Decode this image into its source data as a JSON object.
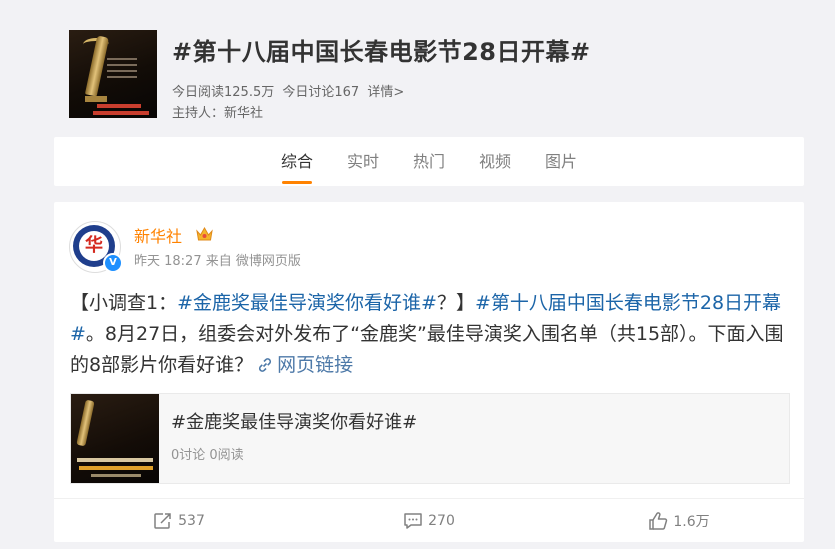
{
  "topic": {
    "title": "#第十八届中国长春电影节28日开幕#",
    "reads_today": "今日阅读125.5万",
    "discussions_today": "今日讨论167",
    "details_link": "详情>",
    "host_label": "主持人：",
    "host_name": "新华社"
  },
  "tabs": [
    {
      "label": "综合",
      "active": true
    },
    {
      "label": "实时",
      "active": false
    },
    {
      "label": "热门",
      "active": false
    },
    {
      "label": "视频",
      "active": false
    },
    {
      "label": "图片",
      "active": false
    }
  ],
  "post": {
    "author": "新华社",
    "time": "昨天 18:27",
    "source": "来自 微博网页版",
    "text_part1": "【小调查1：",
    "hashtag1": "#金鹿奖最佳导演奖你看好谁#",
    "text_part2": "？】",
    "hashtag2": "#第十八届中国长春电影节28日开幕#",
    "text_part3": "。8月27日，组委会对外发布了“金鹿奖”最佳导演奖入围名单（共15部）。下面入围的8部影片你看好谁？",
    "web_link_label": "网页链接",
    "shared": {
      "title": "#金鹿奖最佳导演奖你看好谁#",
      "stats": "0讨论 0阅读"
    },
    "actions": {
      "repost_count": "537",
      "comment_count": "270",
      "like_count": "1.6万"
    }
  },
  "colors": {
    "accent": "#ff8200",
    "link": "#1c65a8",
    "background": "#f2f2f5"
  }
}
